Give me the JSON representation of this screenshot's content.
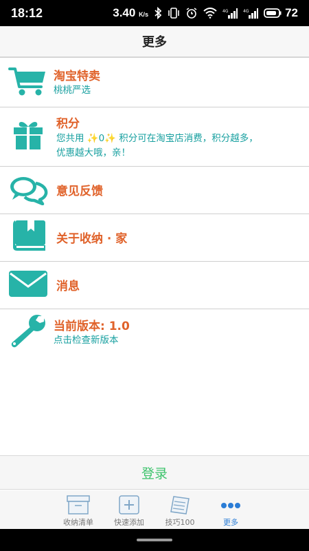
{
  "status_bar": {
    "time": "18:12",
    "speed": "3.40",
    "speed_unit": "K/s",
    "battery": "72"
  },
  "header": {
    "title": "更多"
  },
  "menu": {
    "taobao": {
      "label": "淘宝特卖",
      "sub": "桃桃严选",
      "icon": "cart-icon"
    },
    "points": {
      "label": "积分",
      "sub_line1": "您共用 ✨0✨ 积分可在淘宝店消费，积分越多，",
      "sub_line2": "优惠越大哦，亲！",
      "icon": "gift-icon"
    },
    "feedback": {
      "label": "意见反馈",
      "icon": "chat-bubbles-icon"
    },
    "about": {
      "label": "关于收纳 · 家",
      "icon": "book-icon"
    },
    "messages": {
      "label": "消息",
      "icon": "envelope-icon"
    },
    "version": {
      "label": "当前版本: 1.0",
      "sub": "点击检查新版本",
      "icon": "wrench-icon"
    }
  },
  "login": {
    "label": "登录"
  },
  "tabs": [
    {
      "label": "收纳清单",
      "icon": "box-icon",
      "active": false
    },
    {
      "label": "快速添加",
      "icon": "add-icon",
      "active": false
    },
    {
      "label": "技巧100",
      "icon": "notebook-icon",
      "active": false
    },
    {
      "label": "更多",
      "icon": "more-dots-icon",
      "active": true
    }
  ],
  "colors": {
    "accent_teal": "#27b3a8",
    "label_orange": "#e0622a",
    "sub_teal": "#18a0a0",
    "login_green": "#3cc36b",
    "tab_active": "#2b7dd6"
  }
}
